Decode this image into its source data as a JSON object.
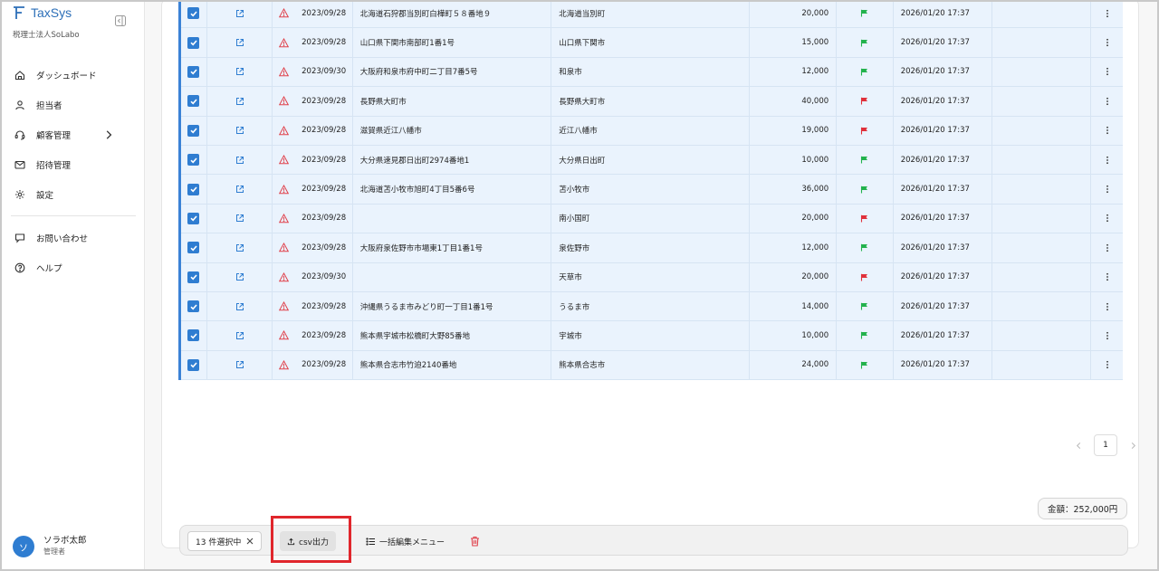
{
  "app": {
    "name": "TaxSys",
    "org": "税理士法人SoLabo",
    "brand_color": "#2c6fb8"
  },
  "sidebar": {
    "items": [
      {
        "label": "ダッシュボード",
        "icon": "home-icon"
      },
      {
        "label": "担当者",
        "icon": "person-icon"
      },
      {
        "label": "顧客管理",
        "icon": "headset-icon"
      },
      {
        "label": "招待管理",
        "icon": "mail-icon"
      },
      {
        "label": "設定",
        "icon": "gear-icon"
      },
      {
        "label": "お問い合わせ",
        "icon": "chat-icon"
      },
      {
        "label": "ヘルプ",
        "icon": "help-icon"
      }
    ]
  },
  "user": {
    "initial": "ソ",
    "name": "ソラボ太郎",
    "role": "管理者"
  },
  "table": {
    "rows": [
      {
        "date": "2023/09/28",
        "address": "北海道石狩郡当別町白樺町５８番地９",
        "city": "北海道当別町",
        "amount": "20,000",
        "flag": "green",
        "updated": "2026/01/20 17:37"
      },
      {
        "date": "2023/09/28",
        "address": "山口県下関市南部町1番1号",
        "city": "山口県下関市",
        "amount": "15,000",
        "flag": "green",
        "updated": "2026/01/20 17:37"
      },
      {
        "date": "2023/09/30",
        "address": "大阪府和泉市府中町二丁目7番5号",
        "city": "和泉市",
        "amount": "12,000",
        "flag": "green",
        "updated": "2026/01/20 17:37"
      },
      {
        "date": "2023/09/28",
        "address": "長野県大町市",
        "city": "長野県大町市",
        "amount": "40,000",
        "flag": "red",
        "updated": "2026/01/20 17:37"
      },
      {
        "date": "2023/09/28",
        "address": "滋賀県近江八幡市",
        "city": "近江八幡市",
        "amount": "19,000",
        "flag": "red",
        "updated": "2026/01/20 17:37"
      },
      {
        "date": "2023/09/28",
        "address": "大分県速見郡日出町2974番地1",
        "city": "大分県日出町",
        "amount": "10,000",
        "flag": "green",
        "updated": "2026/01/20 17:37"
      },
      {
        "date": "2023/09/28",
        "address": "北海道苫小牧市旭町4丁目5番6号",
        "city": "苫小牧市",
        "amount": "36,000",
        "flag": "green",
        "updated": "2026/01/20 17:37"
      },
      {
        "date": "2023/09/28",
        "address": "",
        "city": "南小国町",
        "amount": "20,000",
        "flag": "red",
        "updated": "2026/01/20 17:37"
      },
      {
        "date": "2023/09/28",
        "address": "大阪府泉佐野市市場東1丁目1番1号",
        "city": "泉佐野市",
        "amount": "12,000",
        "flag": "green",
        "updated": "2026/01/20 17:37"
      },
      {
        "date": "2023/09/30",
        "address": "",
        "city": "天草市",
        "amount": "20,000",
        "flag": "red",
        "updated": "2026/01/20 17:37"
      },
      {
        "date": "2023/09/28",
        "address": "沖縄県うるま市みどり町一丁目1番1号",
        "city": "うるま市",
        "amount": "14,000",
        "flag": "green",
        "updated": "2026/01/20 17:37"
      },
      {
        "date": "2023/09/28",
        "address": "熊本県宇城市松橋町大野85番地",
        "city": "宇城市",
        "amount": "10,000",
        "flag": "green",
        "updated": "2026/01/20 17:37"
      },
      {
        "date": "2023/09/28",
        "address": "熊本県合志市竹迫2140番地",
        "city": "熊本県合志市",
        "amount": "24,000",
        "flag": "green",
        "updated": "2026/01/20 17:37"
      }
    ]
  },
  "pagination": {
    "current": "1"
  },
  "total": {
    "label": "金額：252,000円"
  },
  "bulkbar": {
    "selected_label": "13 件選択中",
    "csv_label": "csv出力",
    "bulk_edit_label": "一括編集メニュー"
  },
  "colors": {
    "flag_green": "#22b24c",
    "flag_red": "#e0303a",
    "accent": "#2f7dd1",
    "warn": "#e0404a",
    "highlight": "#e0262c"
  }
}
